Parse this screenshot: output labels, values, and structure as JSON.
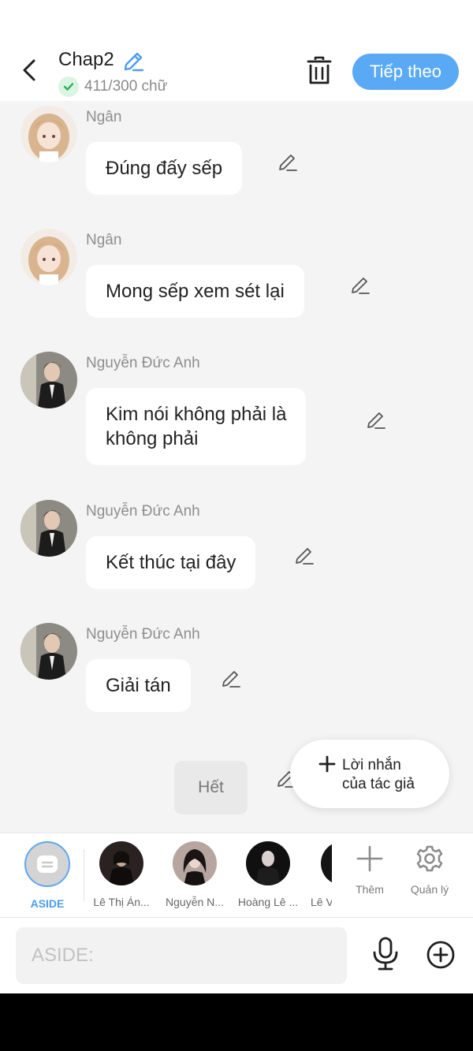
{
  "header": {
    "title": "Chap2",
    "word_count": "411/300 chữ",
    "next_label": "Tiếp theo"
  },
  "messages": [
    {
      "sender": "Ngân",
      "text": "Đúng đấy sếp",
      "avatar": "girl-anime-avatar"
    },
    {
      "sender": "Ngân",
      "text": "Mong sếp xem sét lại",
      "avatar": "girl-anime-avatar"
    },
    {
      "sender": "Nguyễn Đức Anh",
      "text_line1": "Kim nói không phải là",
      "text_line2": "không phải",
      "avatar": "man-photo-avatar"
    },
    {
      "sender": "Nguyễn Đức Anh",
      "text": "Kết thúc tại đây",
      "avatar": "man-photo-avatar"
    },
    {
      "sender": "Nguyễn Đức Anh",
      "text": "Giải tán",
      "avatar": "man-photo-avatar"
    }
  ],
  "end_label": "Hết",
  "author_note": {
    "line1": "Lời nhắn",
    "line2": "của tác giả"
  },
  "characters": {
    "aside": "ASIDE",
    "items": [
      "Lê Thị Án...",
      "Nguyễn N...",
      "Hoàng Lê ...",
      "Lê V"
    ],
    "add_label": "Thêm",
    "manage_label": "Quản lý"
  },
  "input": {
    "placeholder": "ASIDE:"
  },
  "colors": {
    "accent": "#5aa9f5",
    "background": "#f4f4f4",
    "bubble": "#ffffff"
  }
}
